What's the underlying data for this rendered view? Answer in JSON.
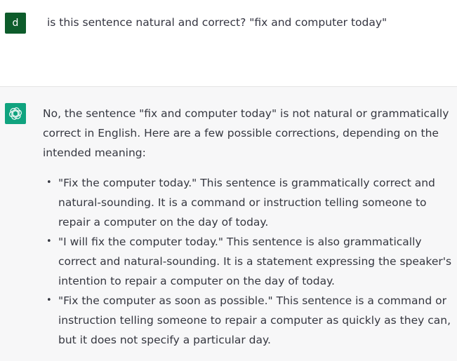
{
  "user": {
    "avatar_letter": "d",
    "avatar_color": "#0d5c2b",
    "message": "is this sentence natural and correct? \"fix and computer today\""
  },
  "assistant": {
    "avatar_icon": "openai-logo-icon",
    "avatar_color": "#10a37f",
    "intro": "No, the sentence \"fix and computer today\" is not natural or grammatically correct in English. Here are a few possible corrections, depending on the intended meaning:",
    "bullets": [
      "\"Fix the computer today.\" This sentence is grammatically correct and natural-sounding. It is a command or instruction telling someone to repair a computer on the day of today.",
      "\"I will fix the computer today.\" This sentence is also grammatically correct and natural-sounding. It is a statement expressing the speaker's intention to repair a computer on the day of today.",
      "\"Fix the computer as soon as possible.\" This sentence is a command or instruction telling someone to repair a computer as quickly as they can, but it does not specify a particular day."
    ]
  }
}
